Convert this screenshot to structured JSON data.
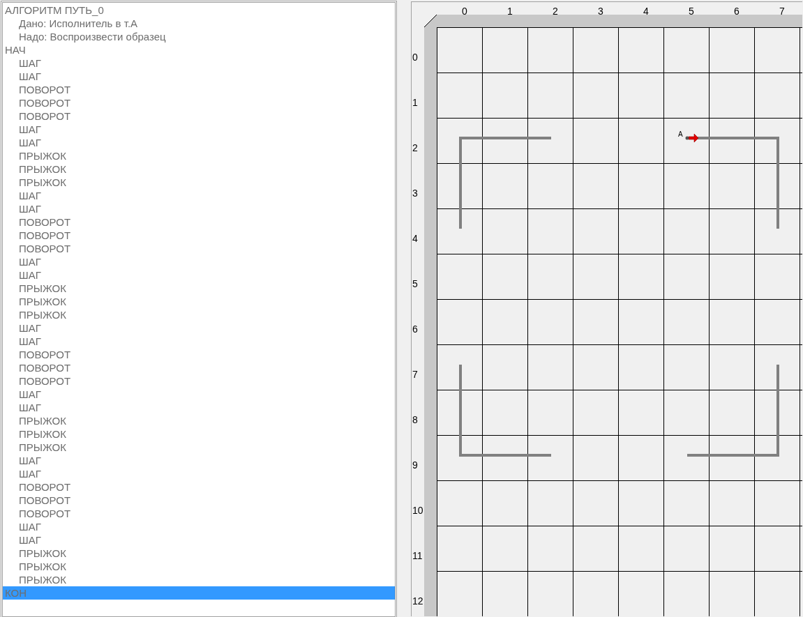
{
  "program": {
    "lines": [
      {
        "text": "АЛГОРИТМ ПУТЬ_0",
        "selected": false,
        "children": [
          {
            "text": "Дано: Исполнитель в т.А",
            "selected": false
          },
          {
            "text": "Надо: Воспроизвести образец",
            "selected": false
          }
        ]
      },
      {
        "text": "НАЧ",
        "selected": false,
        "children": [
          {
            "text": "ШАГ",
            "selected": false
          },
          {
            "text": "ШАГ",
            "selected": false
          },
          {
            "text": "ПОВОРОТ",
            "selected": false
          },
          {
            "text": "ПОВОРОТ",
            "selected": false
          },
          {
            "text": "ПОВОРОТ",
            "selected": false
          },
          {
            "text": "ШАГ",
            "selected": false
          },
          {
            "text": "ШАГ",
            "selected": false
          },
          {
            "text": "ПРЫЖОК",
            "selected": false
          },
          {
            "text": "ПРЫЖОК",
            "selected": false
          },
          {
            "text": "ПРЫЖОК",
            "selected": false
          },
          {
            "text": "ШАГ",
            "selected": false
          },
          {
            "text": "ШАГ",
            "selected": false
          },
          {
            "text": "ПОВОРОТ",
            "selected": false
          },
          {
            "text": "ПОВОРОТ",
            "selected": false
          },
          {
            "text": "ПОВОРОТ",
            "selected": false
          },
          {
            "text": "ШАГ",
            "selected": false
          },
          {
            "text": "ШАГ",
            "selected": false
          },
          {
            "text": "ПРЫЖОК",
            "selected": false
          },
          {
            "text": "ПРЫЖОК",
            "selected": false
          },
          {
            "text": "ПРЫЖОК",
            "selected": false
          },
          {
            "text": "ШАГ",
            "selected": false
          },
          {
            "text": "ШАГ",
            "selected": false
          },
          {
            "text": "ПОВОРОТ",
            "selected": false
          },
          {
            "text": "ПОВОРОТ",
            "selected": false
          },
          {
            "text": "ПОВОРОТ",
            "selected": false
          },
          {
            "text": "ШАГ",
            "selected": false
          },
          {
            "text": "ШАГ",
            "selected": false
          },
          {
            "text": "ПРЫЖОК",
            "selected": false
          },
          {
            "text": "ПРЫЖОК",
            "selected": false
          },
          {
            "text": "ПРЫЖОК",
            "selected": false
          },
          {
            "text": "ШАГ",
            "selected": false
          },
          {
            "text": "ШАГ",
            "selected": false
          },
          {
            "text": "ПОВОРОТ",
            "selected": false
          },
          {
            "text": "ПОВОРОТ",
            "selected": false
          },
          {
            "text": "ПОВОРОТ",
            "selected": false
          },
          {
            "text": "ШАГ",
            "selected": false
          },
          {
            "text": "ШАГ",
            "selected": false
          },
          {
            "text": "ПРЫЖОК",
            "selected": false
          },
          {
            "text": "ПРЫЖОК",
            "selected": false
          },
          {
            "text": "ПРЫЖОК",
            "selected": false
          }
        ]
      },
      {
        "text": "КОН",
        "selected": true
      }
    ]
  },
  "field": {
    "columns": [
      "0",
      "1",
      "2",
      "3",
      "4",
      "5",
      "6",
      "7"
    ],
    "rows": [
      "0",
      "1",
      "2",
      "3",
      "4",
      "5",
      "6",
      "7",
      "8",
      "9",
      "10",
      "11",
      "12"
    ],
    "executor": {
      "label": "А"
    }
  }
}
